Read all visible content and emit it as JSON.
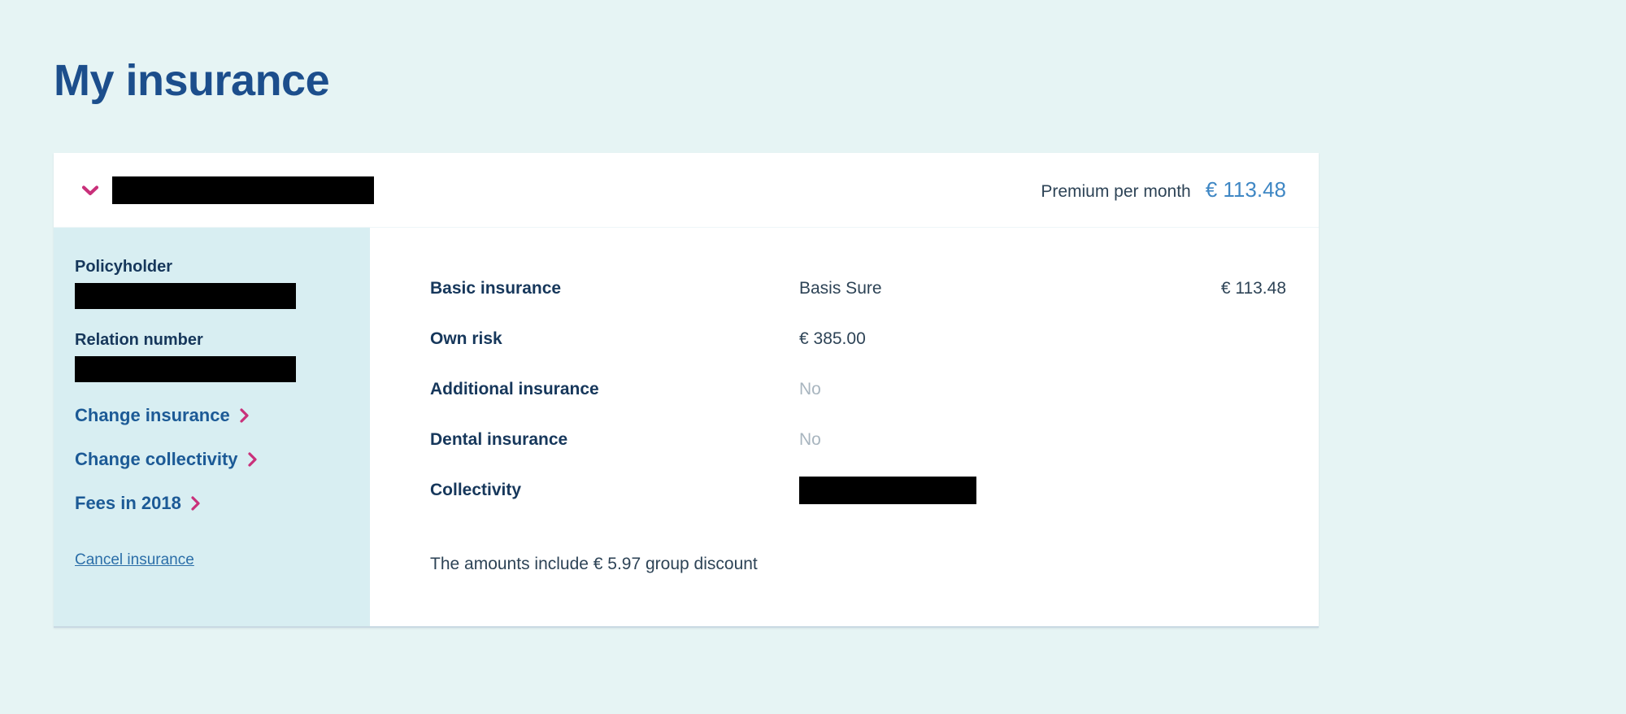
{
  "page": {
    "title": "My insurance",
    "background_color": "#e6f4f4",
    "accent_color": "#c9307a",
    "title_color": "#1c4e8c"
  },
  "header": {
    "toggle_icon": "chevron-down-icon",
    "policy_name_redacted": true,
    "premium_label": "Premium per month",
    "premium_value": "€ 113.48"
  },
  "sidebar": {
    "fields": [
      {
        "label": "Policyholder",
        "value_redacted": true
      },
      {
        "label": "Relation number",
        "value_redacted": true
      }
    ],
    "links": [
      {
        "label": "Change insurance",
        "icon": "chevron-right-icon"
      },
      {
        "label": "Change collectivity",
        "icon": "chevron-right-icon"
      },
      {
        "label": "Fees in 2018",
        "icon": "chevron-right-icon"
      }
    ],
    "cancel_link": "Cancel insurance"
  },
  "detail": {
    "rows": [
      {
        "label": "Basic insurance",
        "value": "Basis Sure",
        "amount": "€ 113.48",
        "muted": false,
        "redacted": false
      },
      {
        "label": "Own risk",
        "value": "€ 385.00",
        "amount": "",
        "muted": false,
        "redacted": false
      },
      {
        "label": "Additional insurance",
        "value": "No",
        "amount": "",
        "muted": true,
        "redacted": false
      },
      {
        "label": "Dental insurance",
        "value": "No",
        "amount": "",
        "muted": true,
        "redacted": false
      },
      {
        "label": "Collectivity",
        "value": "",
        "amount": "",
        "muted": false,
        "redacted": true
      }
    ],
    "note": "The amounts include € 5.97 group discount"
  }
}
